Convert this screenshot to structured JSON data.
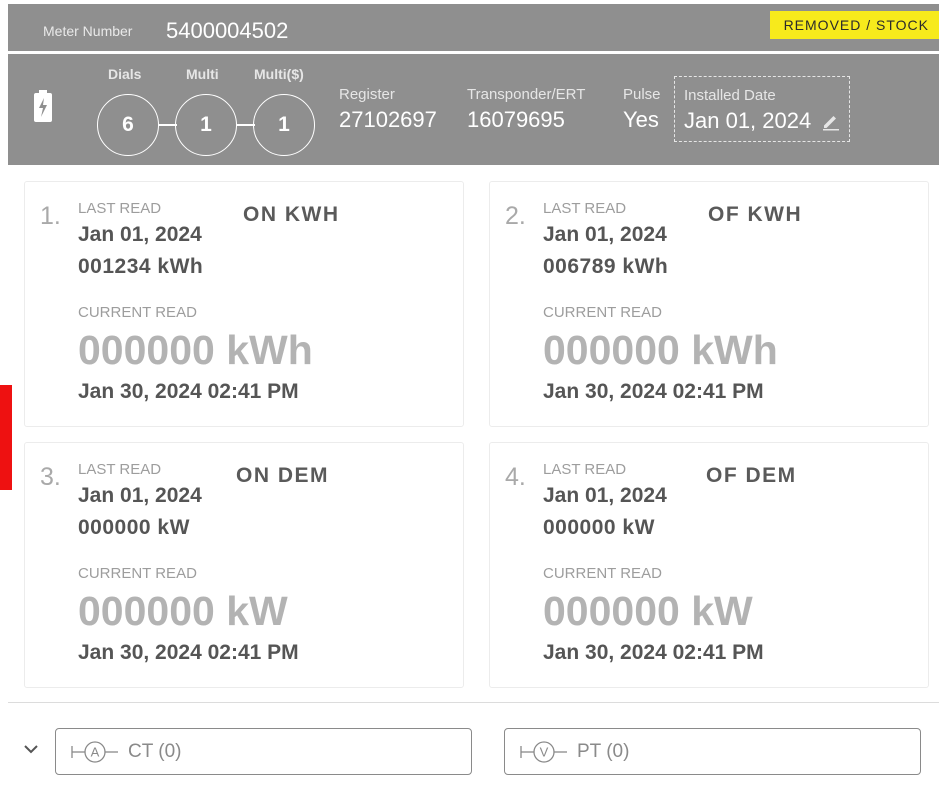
{
  "header": {
    "meter_label": "Meter Number",
    "meter_number": "5400004502",
    "status": "REMOVED / STOCK"
  },
  "info": {
    "battery_icon": "battery-charging-icon",
    "dials": [
      {
        "label": "Dials",
        "value": "6"
      },
      {
        "label": "Multi",
        "value": "1"
      },
      {
        "label": "Multi($)",
        "value": "1"
      }
    ],
    "register_label": "Register",
    "register_value": "27102697",
    "transponder_label": "Transponder/ERT",
    "transponder_value": "16079695",
    "pulse_label": "Pulse",
    "pulse_value": "Yes",
    "installed_label": "Installed Date",
    "installed_value": "Jan 01, 2024",
    "edit_icon": "pencil-icon"
  },
  "reads": [
    {
      "index": "1.",
      "last_read_label": "LAST READ",
      "last_read_date": "Jan 01, 2024",
      "last_read_value": "001234 kWh",
      "name": "ON KWH",
      "current_read_label": "CURRENT READ",
      "current_read_value": "000000 kWh",
      "current_read_date": "Jan 30, 2024 02:41 PM"
    },
    {
      "index": "2.",
      "last_read_label": "LAST READ",
      "last_read_date": "Jan 01, 2024",
      "last_read_value": "006789 kWh",
      "name": "OF KWH",
      "current_read_label": "CURRENT READ",
      "current_read_value": "000000 kWh",
      "current_read_date": "Jan 30, 2024 02:41 PM"
    },
    {
      "index": "3.",
      "last_read_label": "LAST READ",
      "last_read_date": "Jan 01, 2024",
      "last_read_value": "000000 kW",
      "name": "ON DEM",
      "current_read_label": "CURRENT READ",
      "current_read_value": "000000 kW",
      "current_read_date": "Jan 30, 2024 02:41 PM"
    },
    {
      "index": "4.",
      "last_read_label": "LAST READ",
      "last_read_date": "Jan 01, 2024",
      "last_read_value": "000000 kW",
      "name": "OF DEM",
      "current_read_label": "CURRENT READ",
      "current_read_value": "000000 kW",
      "current_read_date": "Jan 30, 2024 02:41 PM"
    }
  ],
  "footer": {
    "expand_icon": "chevron-down-icon",
    "ct_symbol": "A",
    "ct_label": "CT (0)",
    "pt_symbol": "V",
    "pt_label": "PT (0)"
  },
  "colors": {
    "header_bg": "#8f8f8f",
    "status_badge": "#f7ea1c",
    "marker": "#ee1111"
  }
}
